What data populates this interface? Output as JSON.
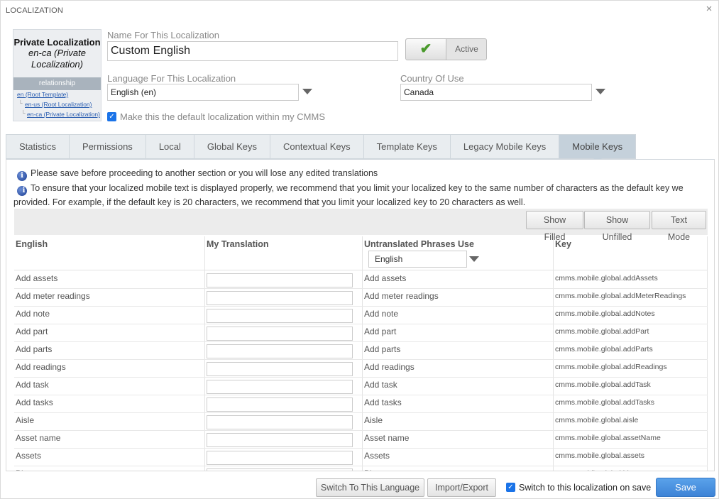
{
  "window": {
    "title": "LOCALIZATION",
    "close_icon": "×"
  },
  "relationship_panel": {
    "name": "Private Localization",
    "subtitle": "en-ca (Private Localization)",
    "header": "relationship",
    "links": [
      "en (Root Template)",
      "en-us (Root Localization)",
      "en-ca (Private Localization)"
    ]
  },
  "form": {
    "name_label": "Name For This Localization",
    "name_value": "Custom English",
    "active_label": "Active",
    "language_label": "Language For This Localization",
    "language_value": "English (en)",
    "country_label": "Country Of Use",
    "country_value": "Canada",
    "default_checkbox_label": "Make this the default localization within my CMMS",
    "default_checked": true
  },
  "tabs": [
    {
      "label": "Statistics"
    },
    {
      "label": "Permissions"
    },
    {
      "label": "Local"
    },
    {
      "label": "Global Keys"
    },
    {
      "label": "Contextual Keys"
    },
    {
      "label": "Template Keys"
    },
    {
      "label": "Legacy Mobile Keys"
    },
    {
      "label": "Mobile Keys"
    }
  ],
  "selected_tab": "Mobile Keys",
  "notices": [
    "Please save before proceeding to another section or you will lose any edited translations",
    "To ensure that your localized mobile text is displayed properly, we recommend that you limit your localized key to the same number of characters as the default key we provided. For example, if the default key is 20 characters, we recommend that you limit your localized key to 20 characters as well."
  ],
  "toolbar": {
    "show_filled": "Show Filled",
    "show_unfilled": "Show Unfilled",
    "text_mode": "Text Mode"
  },
  "grid": {
    "headers": {
      "english": "English",
      "translation": "My Translation",
      "untranslated": "Untranslated Phrases Use",
      "key": "Key"
    },
    "untranslated_select": "English",
    "rows": [
      {
        "english": "Add assets",
        "untranslated": "Add assets",
        "key": "cmms.mobile.global.addAssets"
      },
      {
        "english": "Add meter readings",
        "untranslated": "Add meter readings",
        "key": "cmms.mobile.global.addMeterReadings"
      },
      {
        "english": "Add note",
        "untranslated": "Add note",
        "key": "cmms.mobile.global.addNotes"
      },
      {
        "english": "Add part",
        "untranslated": "Add part",
        "key": "cmms.mobile.global.addPart"
      },
      {
        "english": "Add parts",
        "untranslated": "Add parts",
        "key": "cmms.mobile.global.addParts"
      },
      {
        "english": "Add readings",
        "untranslated": "Add readings",
        "key": "cmms.mobile.global.addReadings"
      },
      {
        "english": "Add task",
        "untranslated": "Add task",
        "key": "cmms.mobile.global.addTask"
      },
      {
        "english": "Add tasks",
        "untranslated": "Add tasks",
        "key": "cmms.mobile.global.addTasks"
      },
      {
        "english": "Aisle",
        "untranslated": "Aisle",
        "key": "cmms.mobile.global.aisle"
      },
      {
        "english": "Asset name",
        "untranslated": "Asset name",
        "key": "cmms.mobile.global.assetName"
      },
      {
        "english": "Assets",
        "untranslated": "Assets",
        "key": "cmms.mobile.global.assets"
      },
      {
        "english": "Bin",
        "untranslated": "Bin",
        "key": "cmms.mobile.global.bin"
      }
    ]
  },
  "footer": {
    "switch_language": "Switch To This Language",
    "import_export": "Import/Export",
    "switch_checkbox_label": "Switch to this localization on save",
    "save": "Save"
  },
  "colors": {
    "accent": "#3d83d6",
    "tab_selected": "#c5d1db",
    "checkbox": "#1a73e8",
    "check_green": "#4a9a2c"
  }
}
